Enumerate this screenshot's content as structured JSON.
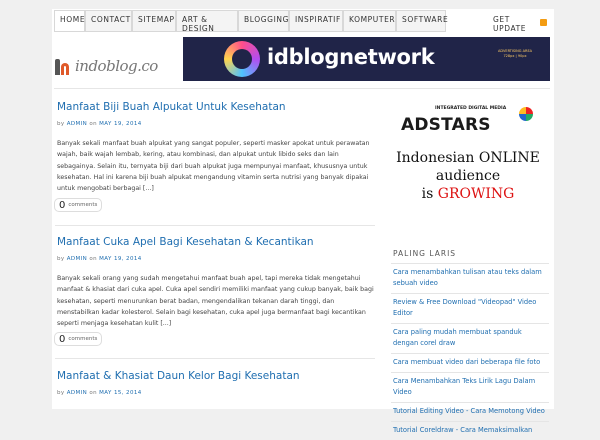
{
  "nav": {
    "items": [
      "HOME",
      "CONTACT",
      "SITEMAP",
      "ART & DESIGN",
      "BLOGGING",
      "INSPIRATIF",
      "KOMPUTER",
      "SOFTWARE"
    ],
    "get_update": "GET UPDATE"
  },
  "header": {
    "logo_text": "indoblog.co",
    "banner_text": "idblognetwork",
    "banner_ad_text": "ADVERTISING AREA 728px | 90px"
  },
  "posts": [
    {
      "title": "Manfaat Biji Buah Alpukat Untuk Kesehatan",
      "by": "by",
      "author": "ADMIN",
      "on": "on",
      "date": "MAY 19, 2014",
      "excerpt": "Banyak sekali manfaat buah alpukat yang sangat populer, seperti masker apokat untuk perawatan wajah, baik wajah lembab, kering, atau kombinasi, dan alpukat untuk libido seks dan lain sebagainya. Selain itu, ternyata biji dari buah alpukat juga mempunyai manfaat, khususnya untuk kesehatan. Hal ini karena biji buah alpukat mengandung vitamin serta nutrisi yang banyak dipakai untuk mengobati berbagai [...]",
      "comments_count": "0",
      "comments_label": "comments"
    },
    {
      "title": "Manfaat Cuka Apel Bagi Kesehatan & Kecantikan",
      "by": "by",
      "author": "ADMIN",
      "on": "on",
      "date": "MAY 19, 2014",
      "excerpt": "Banyak sekali orang yang sudah mengetahui manfaat buah apel, tapi mereka tidak mengetahui manfaat & khasiat dari cuka apel. Cuka apel sendiri memiliki manfaat yang cukup banyak, baik bagi kesehatan, seperti menurunkan berat badan, mengendalikan tekanan darah tinggi, dan menstabilkan kadar kolesterol. Selain bagi kesehatan, cuka apel juga bermanfaat bagi kecantikan seperti menjaga kesehatan kulit [...]",
      "comments_count": "0",
      "comments_label": "comments"
    },
    {
      "title": "Manfaat & Khasiat Daun Kelor Bagi Kesehatan",
      "by": "by",
      "author": "ADMIN",
      "on": "on",
      "date": "MAY 15, 2014"
    }
  ],
  "sidebar_ad": {
    "tag": "INTEGRATED DIGITAL MEDIA",
    "brand": "ADSTARS",
    "line1": "Indonesian ONLINE",
    "line2": "audience",
    "line3_is": "is",
    "line3_grow": "GROWING"
  },
  "sidebar": {
    "heading": "PALING LARIS",
    "links": [
      "Cara menambahkan tulisan atau teks dalam sebuah video",
      "Review & Free Download \"Videopad\" Video Editor",
      "Cara paling mudah membuat spanduk dengan corel draw",
      "Cara membuat video dari beberapa file foto",
      "Cara Menambahkan Teks Lirik Lagu Dalam Video",
      "Tutorial Editing Video - Cara Memotong Video",
      "Tutorial Coreldraw - Cara Memaksimalkan"
    ]
  },
  "colors": {
    "link": "#1f6eb0",
    "accent_orange": "#e05a2a",
    "banner_bg": "#202448",
    "growing_red": "#d11111"
  }
}
